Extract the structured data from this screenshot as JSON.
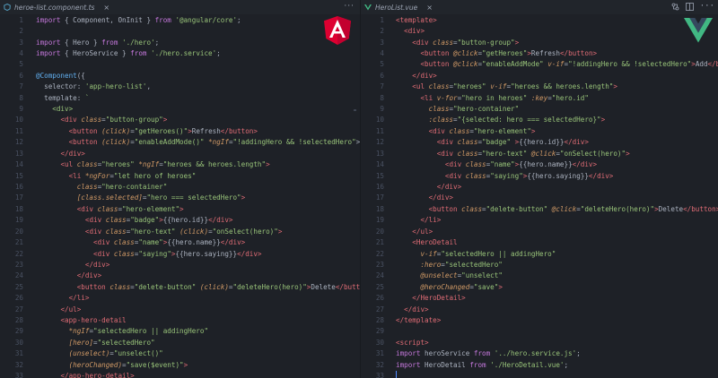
{
  "left": {
    "tab": {
      "filename": "heroe-list.component.ts",
      "close": "×",
      "icon": "typescript-file-icon"
    },
    "more": "···",
    "logo": {
      "name": "angular-logo",
      "color": "#dd0031",
      "letter": "A"
    },
    "lines": [
      {
        "n": "1",
        "html": "<span class='kw'>import</span> { Component, OnInit } <span class='kw'>from</span> <span class='str'>'@angular/core'</span>;"
      },
      {
        "n": "2",
        "html": ""
      },
      {
        "n": "3",
        "html": "<span class='kw'>import</span> { Hero } <span class='kw'>from</span> <span class='str'>'./hero'</span>;"
      },
      {
        "n": "4",
        "html": "<span class='kw'>import</span> { HeroService } <span class='kw'>from</span> <span class='str'>'./hero.service'</span>;"
      },
      {
        "n": "5",
        "html": ""
      },
      {
        "n": "6",
        "html": "<span class='dec'>@Component</span>({"
      },
      {
        "n": "7",
        "html": "  selector: <span class='str'>'app-hero-list'</span>,"
      },
      {
        "n": "8",
        "html": "  template: <span class='str'>`</span>"
      },
      {
        "n": "9",
        "html": "<span class='str'>    &lt;div&gt;</span>"
      },
      {
        "n": "10",
        "html": "      <span class='tag'>&lt;div</span> <span class='attr'>class</span>=<span class='str'>\"button-group\"</span><span class='tag'>&gt;</span>"
      },
      {
        "n": "11",
        "html": "        <span class='tag'>&lt;button</span> <span class='attr'>(click)</span>=<span class='str'>\"getHeroes()\"</span><span class='tag'>&gt;</span>Refresh<span class='tag'>&lt;/button&gt;</span>"
      },
      {
        "n": "12",
        "html": "        <span class='tag'>&lt;button</span> <span class='attr'>(click)</span>=<span class='str'>\"enableAddMode()\"</span> <span class='attr'>*ngIf</span>=<span class='str'>\"!addingHero &amp;&amp; !selectedHero\"</span>&gt;"
      },
      {
        "n": "13",
        "html": "      <span class='tag'>&lt;/div&gt;</span>"
      },
      {
        "n": "14",
        "html": "      <span class='tag'>&lt;ul</span> <span class='attr'>class</span>=<span class='str'>\"heroes\"</span> <span class='attr'>*ngIf</span>=<span class='str'>\"heroes &amp;&amp; heroes.length\"</span><span class='tag'>&gt;</span>"
      },
      {
        "n": "15",
        "html": "        <span class='tag'>&lt;li</span> <span class='attr'>*ngFor</span>=<span class='str'>\"let hero of heroes\"</span>"
      },
      {
        "n": "16",
        "html": "          <span class='attr'>class</span>=<span class='str'>\"hero-container\"</span>"
      },
      {
        "n": "17",
        "html": "          <span class='attr'>[class.selected]</span>=<span class='str'>\"hero === selectedHero\"</span><span class='tag'>&gt;</span>"
      },
      {
        "n": "18",
        "html": "          <span class='tag'>&lt;div</span> <span class='attr'>class</span>=<span class='str'>\"hero-element\"</span><span class='tag'>&gt;</span>"
      },
      {
        "n": "19",
        "html": "            <span class='tag'>&lt;div</span> <span class='attr'>class</span>=<span class='str'>\"badge\"</span><span class='tag'>&gt;</span>{{hero.id}}<span class='tag'>&lt;/div&gt;</span>"
      },
      {
        "n": "20",
        "html": "            <span class='tag'>&lt;div</span> <span class='attr'>class</span>=<span class='str'>\"hero-text\"</span> <span class='attr'>(click)</span>=<span class='str'>\"onSelect(hero)\"</span><span class='tag'>&gt;</span>"
      },
      {
        "n": "21",
        "html": "              <span class='tag'>&lt;div</span> <span class='attr'>class</span>=<span class='str'>\"name\"</span><span class='tag'>&gt;</span>{{hero.name}}<span class='tag'>&lt;/div&gt;</span>"
      },
      {
        "n": "22",
        "html": "              <span class='tag'>&lt;div</span> <span class='attr'>class</span>=<span class='str'>\"saying\"</span><span class='tag'>&gt;</span>{{hero.saying}}<span class='tag'>&lt;/div&gt;</span>"
      },
      {
        "n": "23",
        "html": "            <span class='tag'>&lt;/div&gt;</span>"
      },
      {
        "n": "24",
        "html": "          <span class='tag'>&lt;/div&gt;</span>"
      },
      {
        "n": "25",
        "html": "          <span class='tag'>&lt;button</span> <span class='attr'>class</span>=<span class='str'>\"delete-button\"</span> <span class='attr'>(click)</span>=<span class='str'>\"deleteHero(hero)\"</span><span class='tag'>&gt;</span>Delete<span class='tag'>&lt;/butto</span>"
      },
      {
        "n": "26",
        "html": "        <span class='tag'>&lt;/li&gt;</span>"
      },
      {
        "n": "27",
        "html": "      <span class='tag'>&lt;/ul&gt;</span>"
      },
      {
        "n": "28",
        "html": "      <span class='tag'>&lt;app-hero-detail</span>"
      },
      {
        "n": "29",
        "html": "        <span class='attr'>*ngIf</span>=<span class='str'>\"selectedHero || addingHero\"</span>"
      },
      {
        "n": "30",
        "html": "        <span class='attr'>[hero]</span>=<span class='str'>\"selectedHero\"</span>"
      },
      {
        "n": "31",
        "html": "        <span class='attr'>(unselect)</span>=<span class='str'>\"unselect()\"</span>"
      },
      {
        "n": "32",
        "html": "        <span class='attr'>(heroChanged)</span>=<span class='str'>\"save($event)\"</span><span class='tag'>&gt;</span>"
      },
      {
        "n": "33",
        "html": "      <span class='tag'>&lt;/app-hero-detail&gt;</span>"
      }
    ]
  },
  "right": {
    "tab": {
      "filename": "HeroList.vue",
      "close": "×",
      "icon": "vue-file-icon"
    },
    "actions": [
      "compare-icon",
      "split-editor-icon",
      "more-icon"
    ],
    "more": "···",
    "logo": {
      "name": "vue-logo",
      "outer": "#41b883",
      "inner": "#35495e"
    },
    "lines": [
      {
        "n": "1",
        "html": "<span class='tag'>&lt;template&gt;</span>"
      },
      {
        "n": "2",
        "html": "  <span class='tag'>&lt;div&gt;</span>"
      },
      {
        "n": "3",
        "html": "    <span class='tag'>&lt;div</span> <span class='attr'>class</span>=<span class='str'>\"button-group\"</span><span class='tag'>&gt;</span>"
      },
      {
        "n": "4",
        "html": "      <span class='tag'>&lt;button</span> <span class='attr'>@click</span>=<span class='str'>\"getHeroes\"</span><span class='tag'>&gt;</span>Refresh<span class='tag'>&lt;/button&gt;</span>"
      },
      {
        "n": "5",
        "html": "      <span class='tag'>&lt;button</span> <span class='attr'>@click</span>=<span class='str'>\"enableAddMode\"</span> <span class='attr'>v-if</span>=<span class='str'>\"!addingHero &amp;&amp; !selectedHero\"</span><span class='tag'>&gt;</span>Add<span class='tag'>&lt;/bu</span>"
      },
      {
        "n": "6",
        "html": "    <span class='tag'>&lt;/div&gt;</span>"
      },
      {
        "n": "7",
        "html": "    <span class='tag'>&lt;ul</span> <span class='attr'>class</span>=<span class='str'>\"heroes\"</span> <span class='attr'>v-if</span>=<span class='str'>\"heroes &amp;&amp; heroes.length\"</span><span class='tag'>&gt;</span>"
      },
      {
        "n": "8",
        "html": "      <span class='tag'>&lt;li</span> <span class='attr'>v-for</span>=<span class='str'>\"hero in heroes\"</span> <span class='attr'>:key</span>=<span class='str'>\"hero.id\"</span>"
      },
      {
        "n": "9",
        "html": "        <span class='attr'>class</span>=<span class='str'>\"hero-container\"</span>"
      },
      {
        "n": "10",
        "html": "        <span class='attr'>:class</span>=<span class='str'>\"{selected: hero === selectedHero}\"</span><span class='tag'>&gt;</span>"
      },
      {
        "n": "11",
        "html": "        <span class='tag'>&lt;div</span> <span class='attr'>class</span>=<span class='str'>\"hero-element\"</span><span class='tag'>&gt;</span>"
      },
      {
        "n": "12",
        "html": "          <span class='tag'>&lt;div</span> <span class='attr'>class</span>=<span class='str'>\"badge\"</span> <span class='tag'>&gt;</span>{{hero.id}}<span class='tag'>&lt;/div&gt;</span>"
      },
      {
        "n": "13",
        "html": "          <span class='tag'>&lt;div</span> <span class='attr'>class</span>=<span class='str'>\"hero-text\"</span> <span class='attr'>@click</span>=<span class='str'>\"onSelect(hero)\"</span><span class='tag'>&gt;</span>"
      },
      {
        "n": "14",
        "html": "            <span class='tag'>&lt;div</span> <span class='attr'>class</span>=<span class='str'>\"name\"</span><span class='tag'>&gt;</span>{{hero.name}}<span class='tag'>&lt;/div&gt;</span>"
      },
      {
        "n": "15",
        "html": "            <span class='tag'>&lt;div</span> <span class='attr'>class</span>=<span class='str'>\"saying\"</span><span class='tag'>&gt;</span>{{hero.saying}}<span class='tag'>&lt;/div&gt;</span>"
      },
      {
        "n": "16",
        "html": "          <span class='tag'>&lt;/div&gt;</span>"
      },
      {
        "n": "17",
        "html": "        <span class='tag'>&lt;/div&gt;</span>"
      },
      {
        "n": "18",
        "html": "        <span class='tag'>&lt;button</span> <span class='attr'>class</span>=<span class='str'>\"delete-button\"</span> <span class='attr'>@click</span>=<span class='str'>\"deleteHero(hero)\"</span><span class='tag'>&gt;</span>Delete<span class='tag'>&lt;/button&gt;</span>"
      },
      {
        "n": "19",
        "html": "      <span class='tag'>&lt;/li&gt;</span>"
      },
      {
        "n": "20",
        "html": "    <span class='tag'>&lt;/ul&gt;</span>"
      },
      {
        "n": "21",
        "html": "    <span class='tag'>&lt;HeroDetail</span>"
      },
      {
        "n": "22",
        "html": "      <span class='attr'>v-if</span>=<span class='str'>\"selectedHero || addingHero\"</span>"
      },
      {
        "n": "23",
        "html": "      <span class='attr'>:hero</span>=<span class='str'>\"selectedHero\"</span>"
      },
      {
        "n": "24",
        "html": "      <span class='attr'>@unselect</span>=<span class='str'>\"unselect\"</span>"
      },
      {
        "n": "25",
        "html": "      <span class='attr'>@heroChanged</span>=<span class='str'>\"save\"</span><span class='tag'>&gt;</span>"
      },
      {
        "n": "26",
        "html": "    <span class='tag'>&lt;/HeroDetail&gt;</span>"
      },
      {
        "n": "27",
        "html": "  <span class='tag'>&lt;/div&gt;</span>"
      },
      {
        "n": "28",
        "html": "<span class='tag'>&lt;/template&gt;</span>"
      },
      {
        "n": "29",
        "html": ""
      },
      {
        "n": "30",
        "html": "<span class='tag'>&lt;script&gt;</span>"
      },
      {
        "n": "31",
        "html": "<span class='kw'>import</span> heroService <span class='kw'>from</span> <span class='str'>'../hero.service.js'</span>;"
      },
      {
        "n": "32",
        "html": "<span class='kw'>import</span> HeroDetail <span class='kw'>from</span> <span class='str'>'./HeroDetail.vue'</span>;"
      },
      {
        "n": "33",
        "html": ""
      }
    ]
  }
}
